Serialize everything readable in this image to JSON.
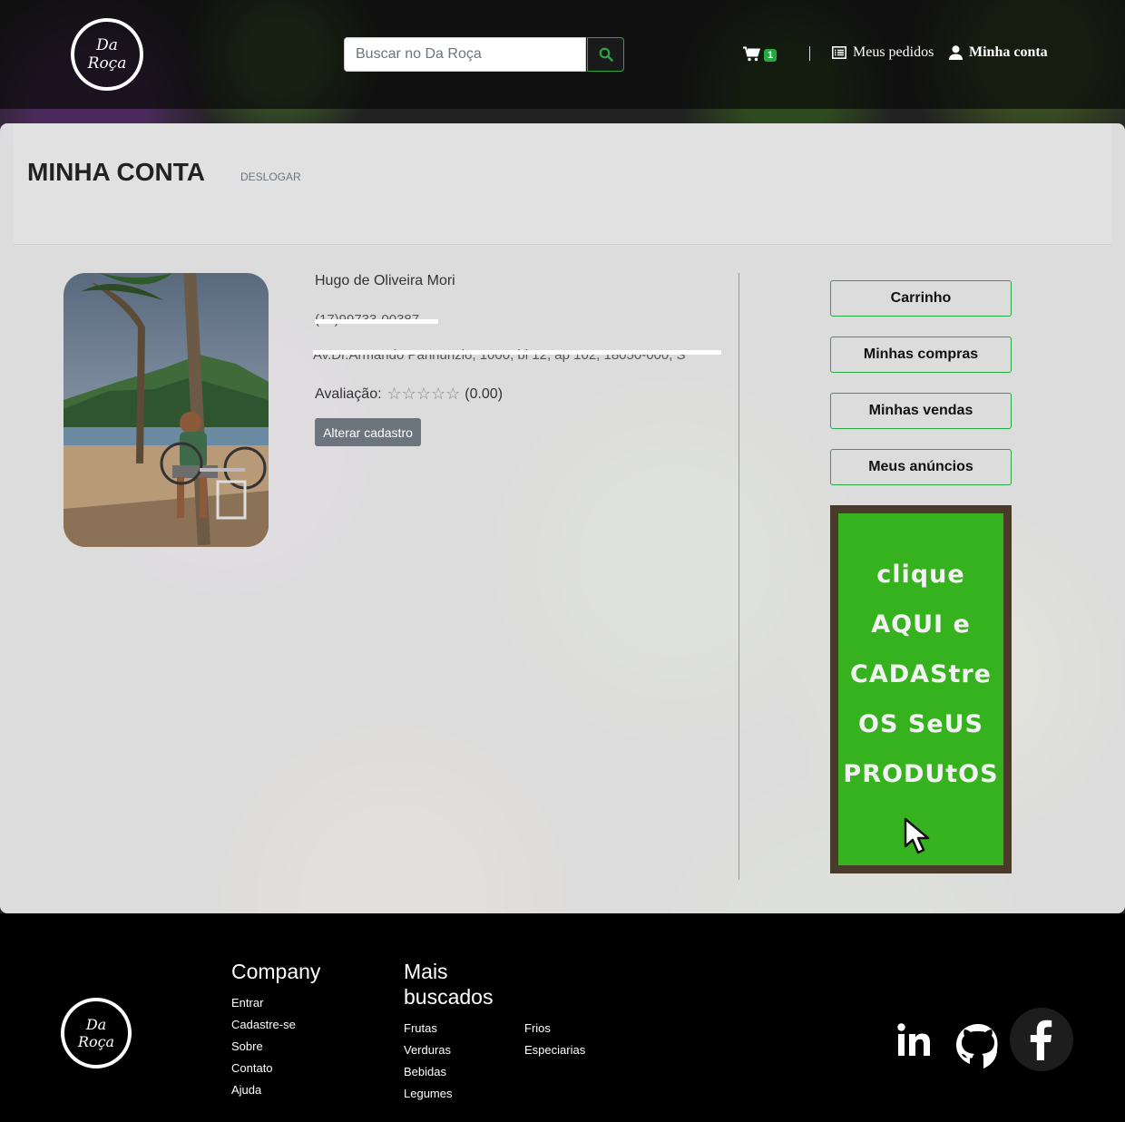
{
  "header": {
    "logo_line1": "Da",
    "logo_line2": "Roça",
    "search_placeholder": "Buscar no Da Roça",
    "cart_count": "1",
    "orders_label": "Meus pedidos",
    "account_label": "Minha conta"
  },
  "page": {
    "title": "MINHA CONTA",
    "logout_label": "DESLOGAR"
  },
  "profile": {
    "name": "Hugo de Oliveira Mori",
    "phone_redacted": "(17)99733-00387",
    "address_redacted": "Av.Dr.Armando Pannunzio, 1000, bl 12, ap 102, 18050-000, S",
    "rating_label": "Avaliação:",
    "rating_value": "(0.00)",
    "rating_stars": 0,
    "edit_label": "Alterar cadastro"
  },
  "sidebar": {
    "buttons": [
      "Carrinho",
      "Minhas compras",
      "Minhas vendas",
      "Meus anúncios"
    ],
    "promo_lines": [
      "clique",
      "AQUI e",
      "CADAStre",
      "OS SeUS",
      "PRODUtOS"
    ]
  },
  "footer": {
    "logo_line1": "Da",
    "logo_line2": "Roça",
    "company_title": "Company",
    "company_links": [
      "Entrar",
      "Cadastre-se",
      "Sobre",
      "Contato",
      "Ajuda"
    ],
    "popular_title_1": "Mais",
    "popular_title_2": "buscados",
    "popular_links_col1": [
      "Frutas",
      "Verduras",
      "Bebidas",
      "Legumes"
    ],
    "popular_links_col2": [
      "Frios",
      "Especiarias"
    ],
    "social": [
      "linkedin-icon",
      "github-icon",
      "facebook-icon"
    ]
  },
  "colors": {
    "accent": "#28a745",
    "promo_green": "#37b21f",
    "promo_border": "#4a3a2a"
  }
}
